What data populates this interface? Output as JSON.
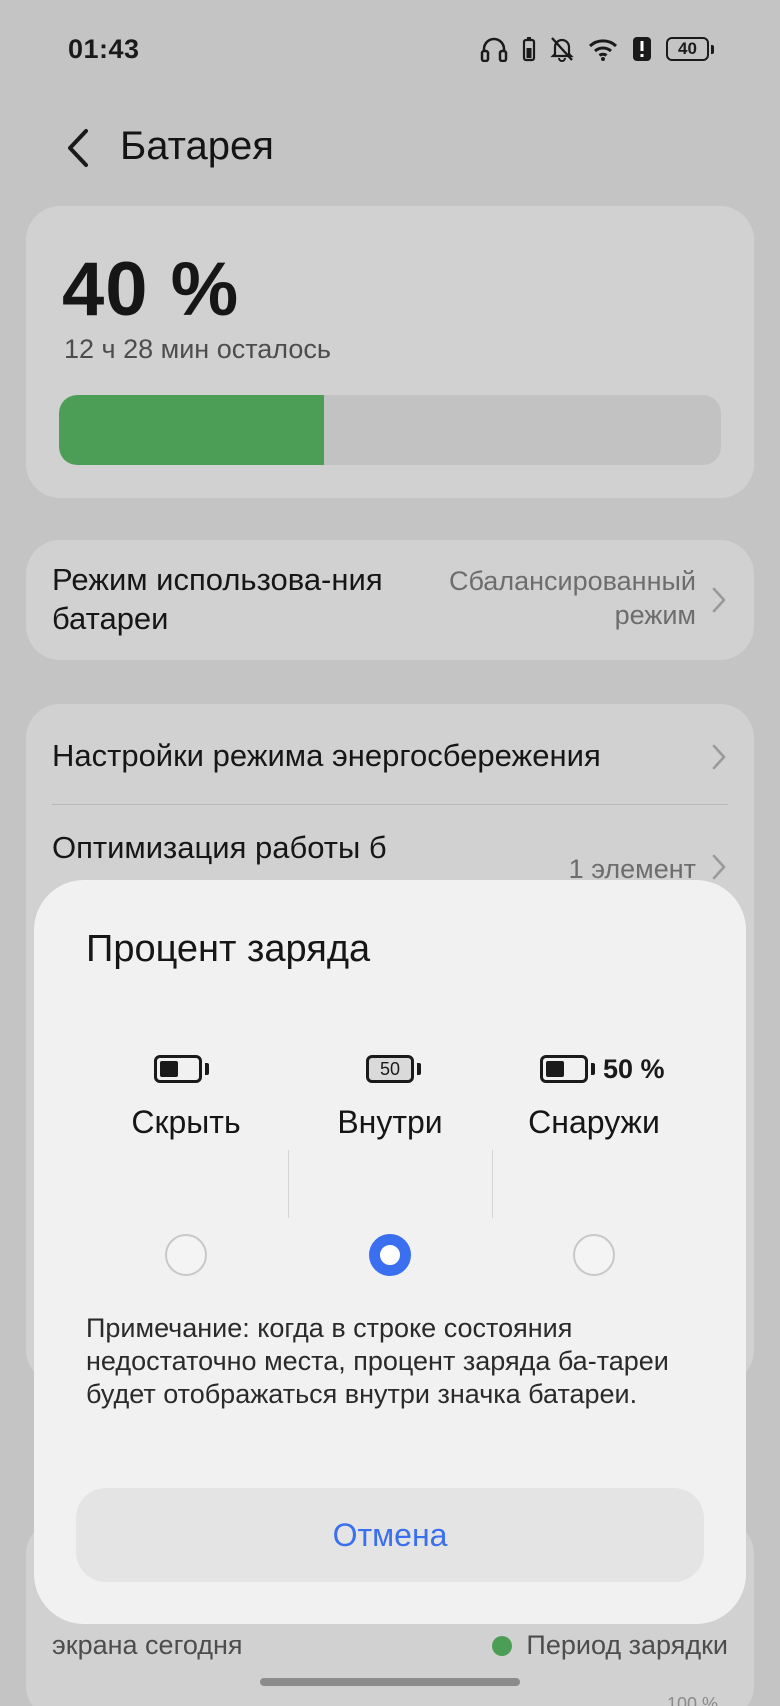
{
  "status_bar": {
    "time": "01:43",
    "battery_level": "40",
    "icons": [
      "headphones-icon",
      "charging-device-icon",
      "muted-bell-icon",
      "wifi-icon",
      "alert-icon",
      "battery-icon"
    ]
  },
  "header": {
    "back_icon": "chevron-left-icon",
    "title": "Батарея"
  },
  "battery_card": {
    "percent": "40 %",
    "remaining": "12 ч 28 мин осталось",
    "level_fraction": 0.4,
    "bar_color": "#4c9e57"
  },
  "mode_row": {
    "label": "Режим использова-ния батареи",
    "value": "Сбалансированный режим"
  },
  "settings_rows": [
    {
      "label": "Настройки режима энергосбережения"
    },
    {
      "label": "Оптимизация работы б",
      "value": "1 элемент"
    }
  ],
  "usage_card": {
    "label": "экрана сегодня",
    "legend": "Период зарядки",
    "axis_top": "100 %"
  },
  "dialog": {
    "title": "Процент заряда",
    "options": [
      {
        "label": "Скрыть",
        "selected": false
      },
      {
        "label": "Внутри",
        "icon_text": "50",
        "selected": true
      },
      {
        "label": "Снаружи",
        "icon_text": "50 %",
        "selected": false
      }
    ],
    "note": "Примечание: когда в строке состояния недостаточно места, процент заряда ба-тареи будет отображаться внутри значка батареи.",
    "cancel_label": "Отмена",
    "accent_color": "#3a6ff0"
  }
}
